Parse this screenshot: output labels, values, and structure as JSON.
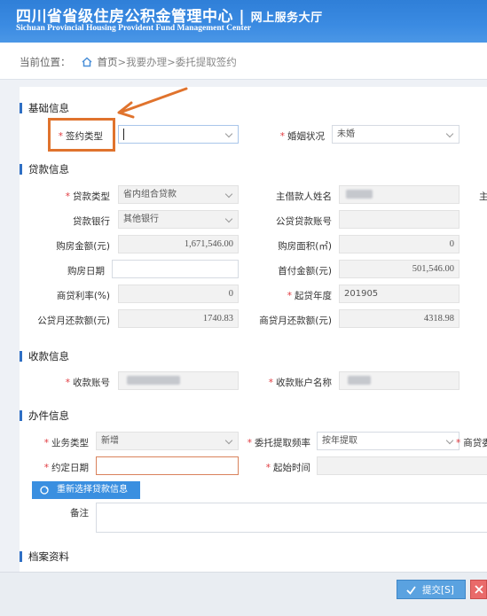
{
  "header": {
    "title": "四川省省级住房公积金管理中心",
    "title_sep": "|",
    "subtitle": "网上服务大厅",
    "title_en": "Sichuan Provincial Housing Provident Fund Management Center"
  },
  "breadcrumb": {
    "label": "当前位置：",
    "home": "首页",
    "items": [
      ">我要办理",
      ">委托提取签约"
    ]
  },
  "sections": {
    "basic": "基础信息",
    "loan": "贷款信息",
    "receive": "收款信息",
    "handle": "办件信息",
    "archive": "档案资料"
  },
  "basic": {
    "sign_type": {
      "label": "签约类型",
      "value": ""
    },
    "marital": {
      "label": "婚姻状况",
      "value": "未婚"
    }
  },
  "loan": {
    "loan_type": {
      "label": "贷款类型",
      "value": "省内组合贷款"
    },
    "borrower_name": {
      "label": "主借款人姓名",
      "value": ""
    },
    "right_cut": "主",
    "bank": {
      "label": "贷款银行",
      "value": "其他银行"
    },
    "pf_account": {
      "label": "公贷贷款账号",
      "value": ""
    },
    "house_amount": {
      "label": "购房金额(元)",
      "value": "1,671,546.00"
    },
    "house_area": {
      "label": "购房面积(㎡)",
      "value": "0"
    },
    "buy_date": {
      "label": "购房日期",
      "value": ""
    },
    "down_payment": {
      "label": "首付金额(元)",
      "value": "501,546.00"
    },
    "comm_rate": {
      "label": "商贷利率(%)",
      "value": "0"
    },
    "start_year": {
      "label": "起贷年度",
      "value": "201905"
    },
    "pf_monthly": {
      "label": "公贷月还款额(元)",
      "value": "1740.83"
    },
    "comm_monthly": {
      "label": "商贷月还款额(元)",
      "value": "4318.98"
    }
  },
  "receive": {
    "account": {
      "label": "收款账号",
      "value": ""
    },
    "account_name": {
      "label": "收款账户名称",
      "value": ""
    }
  },
  "handle": {
    "biz_type": {
      "label": "业务类型",
      "value": "新增"
    },
    "frequency": {
      "label": "委托提取频率",
      "value": "按年提取"
    },
    "comm_cut": "商贷委",
    "agreed_date": {
      "label": "约定日期",
      "value": ""
    },
    "start_time": {
      "label": "起始时间",
      "value": ""
    },
    "reselect_button": "重新选择贷款信息",
    "remark": {
      "label": "备注",
      "value": ""
    }
  },
  "footer": {
    "submit": "提交[S]"
  }
}
